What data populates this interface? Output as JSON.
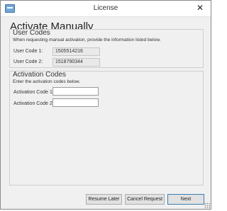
{
  "window": {
    "title": "License",
    "close_glyph": "✕"
  },
  "page": {
    "heading": "Activate Manually"
  },
  "user_codes": {
    "title": "User Codes",
    "description": "When requesting manual activation, provide the information listed below.",
    "rows": [
      {
        "label": "User Code 1:",
        "value": "1505514216"
      },
      {
        "label": "User Code 2:",
        "value": "1518790344"
      }
    ]
  },
  "activation_codes": {
    "title": "Activation Codes",
    "description": "Enter the activation codes below.",
    "rows": [
      {
        "label": "Activation Code 1:",
        "value": ""
      },
      {
        "label": "Activation Code 2:",
        "value": ""
      }
    ]
  },
  "buttons": {
    "resume_later": "Resume Later",
    "cancel_request": "Cancel Request",
    "next": "Next"
  },
  "colors": {
    "window_bg": "#f0f0f0",
    "titlebar_bg": "#ffffff",
    "default_button_border": "#3c7fb1"
  }
}
